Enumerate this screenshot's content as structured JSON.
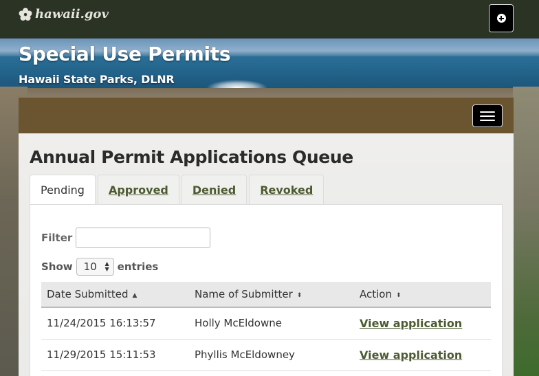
{
  "header": {
    "brand": "hawaii.gov",
    "brand_icon": "hibiscus-icon",
    "action_icon": "plus-circle-icon"
  },
  "site": {
    "title": "Special Use Permits",
    "subtitle": "Hawaii State Parks, DLNR"
  },
  "nav": {
    "menu_icon": "hamburger-menu-icon",
    "color": "#6b5530"
  },
  "page": {
    "heading": "Annual Permit Applications Queue"
  },
  "tabs": [
    {
      "label": "Pending",
      "active": true
    },
    {
      "label": "Approved",
      "active": false
    },
    {
      "label": "Denied",
      "active": false
    },
    {
      "label": "Revoked",
      "active": false
    }
  ],
  "filter": {
    "label": "Filter",
    "value": ""
  },
  "length": {
    "show_label": "Show",
    "selected": "10",
    "entries_label": "entries"
  },
  "table": {
    "columns": [
      "Date Submitted",
      "Name of Submitter",
      "Action"
    ],
    "rows": [
      {
        "date": "11/24/2015 16:13:57",
        "name": "Holly McEldowne",
        "action": "View application"
      },
      {
        "date": "11/29/2015 15:11:53",
        "name": "Phyllis McEldowney",
        "action": "View application"
      }
    ]
  },
  "colors": {
    "topbar": "#2a3324",
    "link": "#4c5a31"
  }
}
